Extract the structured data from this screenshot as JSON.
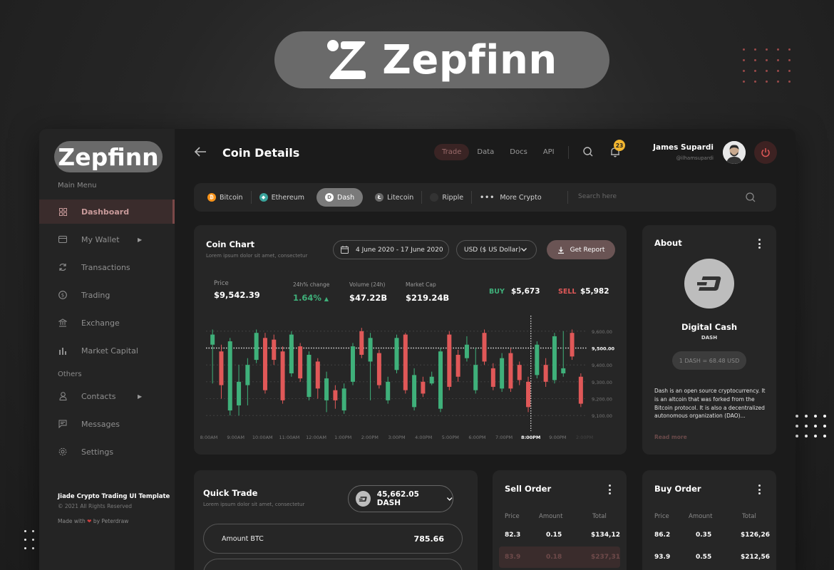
{
  "brand": {
    "name": "Zepfinn"
  },
  "sidebar": {
    "logo": "Zepfinn",
    "main_menu_label": "Main Menu",
    "others_label": "Others",
    "items": [
      {
        "label": "Dashboard",
        "icon": "grid-icon",
        "active": true
      },
      {
        "label": "My Wallet",
        "icon": "wallet-icon",
        "has_submenu": true
      },
      {
        "label": "Transactions",
        "icon": "refresh-icon"
      },
      {
        "label": "Trading",
        "icon": "coin-icon"
      },
      {
        "label": "Exchange",
        "icon": "bank-icon"
      },
      {
        "label": "Market Capital",
        "icon": "bar-chart-icon"
      }
    ],
    "other_items": [
      {
        "label": "Contacts",
        "icon": "user-icon",
        "has_submenu": true
      },
      {
        "label": "Messages",
        "icon": "message-icon"
      },
      {
        "label": "Settings",
        "icon": "gear-icon"
      }
    ],
    "footer": {
      "title": "Jiade Crypto Trading UI Template",
      "copyright": "© 2021 All Rights Reserved",
      "made_prefix": "Made with",
      "made_suffix": "by Peterdraw"
    }
  },
  "header": {
    "title": "Coin Details",
    "nav": [
      "Trade",
      "Data",
      "Docs",
      "API"
    ],
    "active_nav": "Trade",
    "notifications": "23",
    "user": {
      "name": "James Supardi",
      "handle": "@ilhamsupardi"
    }
  },
  "coins": {
    "items": [
      {
        "label": "Bitcoin",
        "symbol": "₿",
        "color": "#f7931a"
      },
      {
        "label": "Ethereum",
        "symbol": "◆",
        "color": "#3aa39b"
      },
      {
        "label": "Dash",
        "symbol": "D",
        "color": "#9a9a9a",
        "active": true
      },
      {
        "label": "Litecoin",
        "symbol": "Ł",
        "color": "#6a6a6a"
      },
      {
        "label": "Ripple",
        "symbol": "",
        "color": "#333333"
      }
    ],
    "more_label": "More Crypto",
    "search_placeholder": "Search here"
  },
  "coin_chart": {
    "title": "Coin Chart",
    "subtitle": "Lorem ipsum dolor sit amet, consectetur",
    "date_range": "4 June 2020 - 17 June 2020",
    "currency": "USD ($ US Dollar)",
    "report_label": "Get Report",
    "stats": {
      "price_label": "Price",
      "price": "$9,542.39",
      "change_label": "24h% change",
      "change": "1.64%",
      "volume_label": "Volume (24h)",
      "volume": "$47.22B",
      "cap_label": "Market Cap",
      "cap": "$219.24B",
      "buy_label": "BUY",
      "buy": "$5,673",
      "sell_label": "SELL",
      "sell": "$5,982"
    }
  },
  "chart_data": {
    "type": "candlestick",
    "x": [
      "8:00AM",
      "9:00AM",
      "10:00AM",
      "11:00AM",
      "12:00AM",
      "1:00PM",
      "2:00PM",
      "3:00PM",
      "4:00PM",
      "5:00PM",
      "6:00PM",
      "7:00PM",
      "8:00PM",
      "9:00PM",
      "2:00PM"
    ],
    "y_ticks": [
      "9,600.00",
      "9,500.00",
      "9,400.00",
      "9,300.00",
      "9,200.00",
      "9,100.00"
    ],
    "ylim": [
      9050,
      9650
    ],
    "highlight_x": "8:00PM",
    "highlight_y": "9,500.00",
    "colors": {
      "up": "#3fb07a",
      "down": "#e05858"
    },
    "candles": [
      {
        "o": 9520,
        "c": 9580,
        "h": 9610,
        "l": 9290
      },
      {
        "o": 9480,
        "c": 9280,
        "h": 9520,
        "l": 9200
      },
      {
        "o": 9130,
        "c": 9540,
        "h": 9560,
        "l": 9100
      },
      {
        "o": 9160,
        "c": 9300,
        "h": 9400,
        "l": 9100
      },
      {
        "o": 9280,
        "c": 9400,
        "h": 9440,
        "l": 9160
      },
      {
        "o": 9430,
        "c": 9590,
        "h": 9610,
        "l": 9410
      },
      {
        "o": 9560,
        "c": 9250,
        "h": 9590,
        "l": 9230
      },
      {
        "o": 9550,
        "c": 9430,
        "h": 9580,
        "l": 9400
      },
      {
        "o": 9480,
        "c": 9190,
        "h": 9510,
        "l": 9170
      },
      {
        "o": 9350,
        "c": 9580,
        "h": 9600,
        "l": 9330
      },
      {
        "o": 9510,
        "c": 9320,
        "h": 9530,
        "l": 9300
      },
      {
        "o": 9210,
        "c": 9460,
        "h": 9480,
        "l": 9190
      },
      {
        "o": 9420,
        "c": 9260,
        "h": 9440,
        "l": 9200
      },
      {
        "o": 9190,
        "c": 9320,
        "h": 9360,
        "l": 9120
      },
      {
        "o": 9250,
        "c": 9190,
        "h": 9280,
        "l": 9140
      },
      {
        "o": 9130,
        "c": 9260,
        "h": 9290,
        "l": 9110
      },
      {
        "o": 9300,
        "c": 9510,
        "h": 9530,
        "l": 9280
      },
      {
        "o": 9600,
        "c": 9460,
        "h": 9620,
        "l": 9440
      },
      {
        "o": 9420,
        "c": 9560,
        "h": 9590,
        "l": 9190
      },
      {
        "o": 9470,
        "c": 9280,
        "h": 9490,
        "l": 9260
      },
      {
        "o": 9190,
        "c": 9300,
        "h": 9330,
        "l": 9170
      },
      {
        "o": 9370,
        "c": 9560,
        "h": 9580,
        "l": 9350
      },
      {
        "o": 9580,
        "c": 9250,
        "h": 9590,
        "l": 9230
      },
      {
        "o": 9150,
        "c": 9340,
        "h": 9380,
        "l": 9130
      },
      {
        "o": 9300,
        "c": 9230,
        "h": 9330,
        "l": 9210
      },
      {
        "o": 9290,
        "c": 9330,
        "h": 9360,
        "l": 9280
      },
      {
        "o": 9140,
        "c": 9480,
        "h": 9500,
        "l": 9120
      },
      {
        "o": 9580,
        "c": 9270,
        "h": 9600,
        "l": 9250
      },
      {
        "o": 9460,
        "c": 9330,
        "h": 9490,
        "l": 9300
      },
      {
        "o": 9440,
        "c": 9520,
        "h": 9570,
        "l": 9420
      },
      {
        "o": 9250,
        "c": 9400,
        "h": 9500,
        "l": 9230
      },
      {
        "o": 9590,
        "c": 9420,
        "h": 9610,
        "l": 9400
      },
      {
        "o": 9380,
        "c": 9270,
        "h": 9410,
        "l": 9250
      },
      {
        "o": 9260,
        "c": 9440,
        "h": 9470,
        "l": 9240
      },
      {
        "o": 9470,
        "c": 9260,
        "h": 9500,
        "l": 9240
      },
      {
        "o": 9400,
        "c": 9310,
        "h": 9420,
        "l": 9280
      },
      {
        "o": 9300,
        "c": 9150,
        "h": 9330,
        "l": 9120
      },
      {
        "o": 9340,
        "c": 9520,
        "h": 9540,
        "l": 9320
      },
      {
        "o": 9400,
        "c": 9300,
        "h": 9440,
        "l": 9270
      },
      {
        "o": 9310,
        "c": 9570,
        "h": 9590,
        "l": 9290
      },
      {
        "o": 9350,
        "c": 9380,
        "h": 9600,
        "l": 9330
      },
      {
        "o": 9590,
        "c": 9450,
        "h": 9610,
        "l": 9430
      },
      {
        "o": 9330,
        "c": 9170,
        "h": 9350,
        "l": 9150
      }
    ]
  },
  "about": {
    "title": "About",
    "name": "Digital Cash",
    "symbol": "DASH",
    "rate": "1 DASH = 68.48 USD",
    "description": "Dash is an open source cryptocurrency. It is an altcoin that was forked from the Bitcoin protocol. It is also a decentralized autonomous organization (DAO)...",
    "read_more": "Read more"
  },
  "quick_trade": {
    "title": "Quick Trade",
    "subtitle": "Lorem ipsum dolor sit amet, consectetur",
    "balance": "45,662.05 DASH",
    "amount_label": "Amount BTC",
    "amount_value": "785.66"
  },
  "sell_order": {
    "title": "Sell Order",
    "headers": [
      "Price",
      "Amount",
      "Total"
    ],
    "rows": [
      [
        "82.3",
        "0.15",
        "$134,12"
      ],
      [
        "83.9",
        "0.18",
        "$237,31"
      ]
    ]
  },
  "buy_order": {
    "title": "Buy Order",
    "headers": [
      "Price",
      "Amount",
      "Total"
    ],
    "rows": [
      [
        "86.2",
        "0.35",
        "$126,26"
      ],
      [
        "93.9",
        "0.55",
        "$212,56"
      ]
    ]
  }
}
